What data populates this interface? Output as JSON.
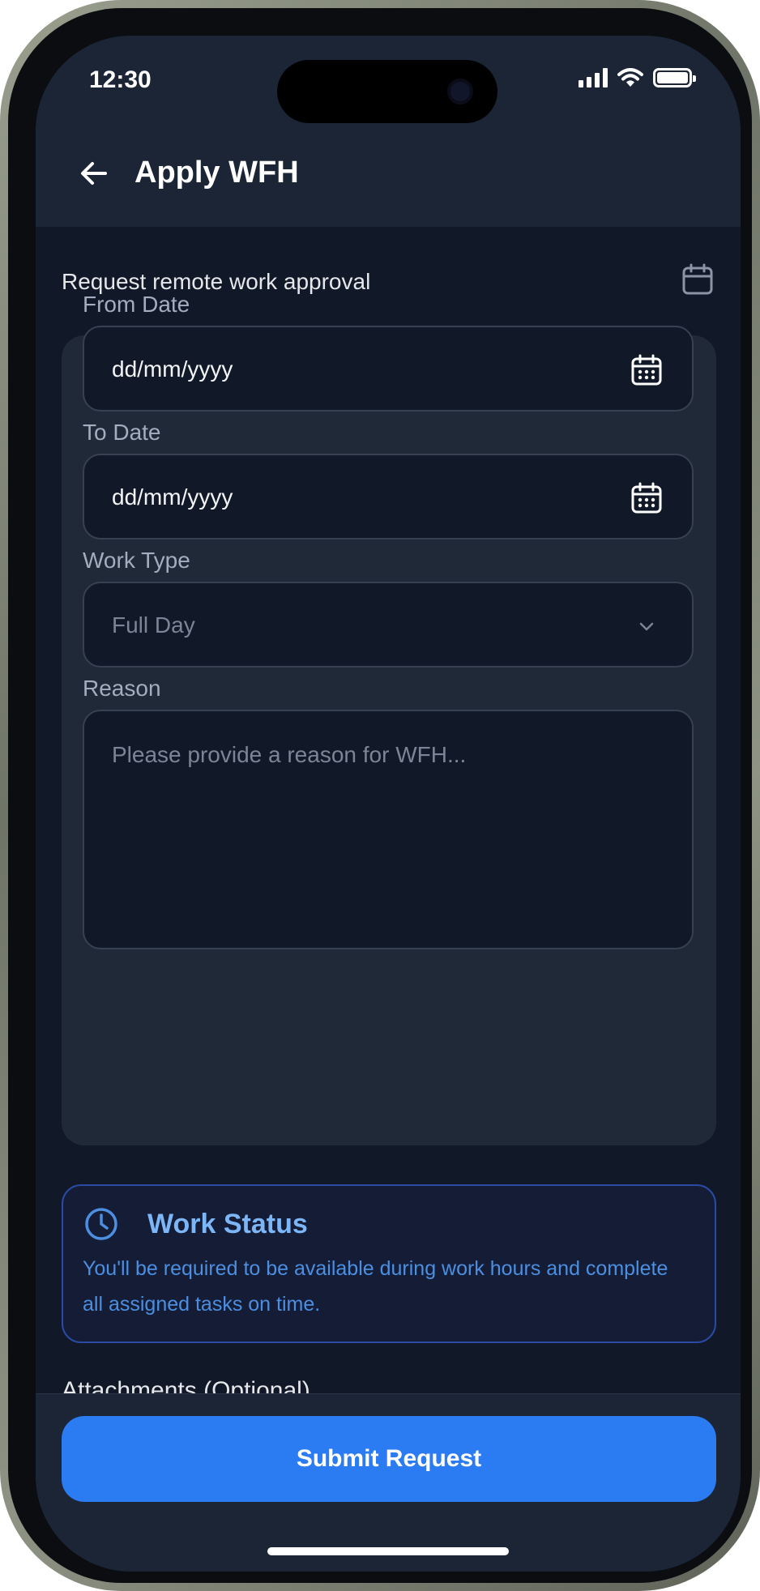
{
  "status_bar": {
    "time": "12:30"
  },
  "header": {
    "title": "Apply WFH"
  },
  "intro": {
    "subtitle": "Request remote work approval"
  },
  "form": {
    "from_date": {
      "label": "From Date",
      "placeholder": "dd/mm/yyyy"
    },
    "to_date": {
      "label": "To Date",
      "placeholder": "dd/mm/yyyy"
    },
    "work_type": {
      "label": "Work Type",
      "selected": "Full Day"
    },
    "reason": {
      "label": "Reason",
      "placeholder": "Please provide a reason for WFH..."
    }
  },
  "work_status": {
    "title": "Work Status",
    "message": "You'll be required to be available during work hours and complete all assigned tasks on time."
  },
  "attachments": {
    "label": "Attachments (Optional)"
  },
  "actions": {
    "submit_label": "Submit Request"
  },
  "colors": {
    "background": "#111827",
    "card": "#1f2937",
    "accent": "#2b7bf2",
    "info_text": "#4c8fe0"
  },
  "icons": [
    "back-arrow-icon",
    "calendar-icon",
    "chevron-down-icon",
    "clock-icon",
    "wifi-icon",
    "signal-icon",
    "battery-icon"
  ]
}
